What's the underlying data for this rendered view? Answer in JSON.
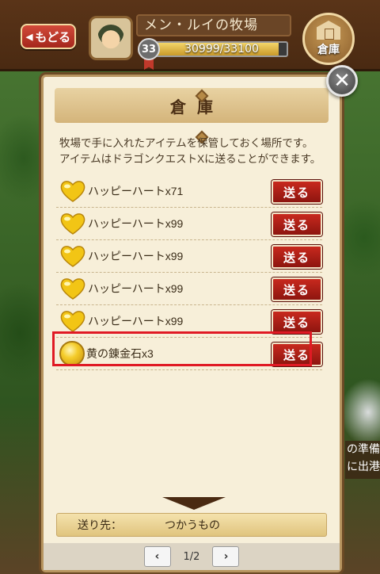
{
  "topbar": {
    "back_label": "もどる",
    "farm_name": "メン・ルイの牧場",
    "level": "33",
    "exp_text": "30999/33100",
    "exp_fraction": 0.9365,
    "warehouse_label": "倉庫"
  },
  "modal": {
    "title": "倉庫",
    "close_label": "✕",
    "description_line1": "牧場で手に入れたアイテムを保管しておく場所です。",
    "description_line2": "アイテムはドラゴンクエストXに送ることができます。",
    "send_label": "送る",
    "items": [
      {
        "icon": "heart-icon",
        "label": "ハッピーハートx71"
      },
      {
        "icon": "heart-icon",
        "label": "ハッピーハートx99"
      },
      {
        "icon": "heart-icon",
        "label": "ハッピーハートx99"
      },
      {
        "icon": "heart-icon",
        "label": "ハッピーハートx99"
      },
      {
        "icon": "heart-icon",
        "label": "ハッピーハートx99"
      },
      {
        "icon": "gold-stone-icon",
        "label": "黄の錬金石x3"
      }
    ],
    "destination_label": "送り先：",
    "destination_value": "つかうもの",
    "page_indicator": "1/2",
    "prev_label": "‹",
    "next_label": "›"
  },
  "side": {
    "line1": "の準備",
    "line2": "に出港で"
  },
  "colors": {
    "send_button": "#c8291e",
    "highlight": "#e01a24",
    "modal_bg": "#f7efd9"
  }
}
